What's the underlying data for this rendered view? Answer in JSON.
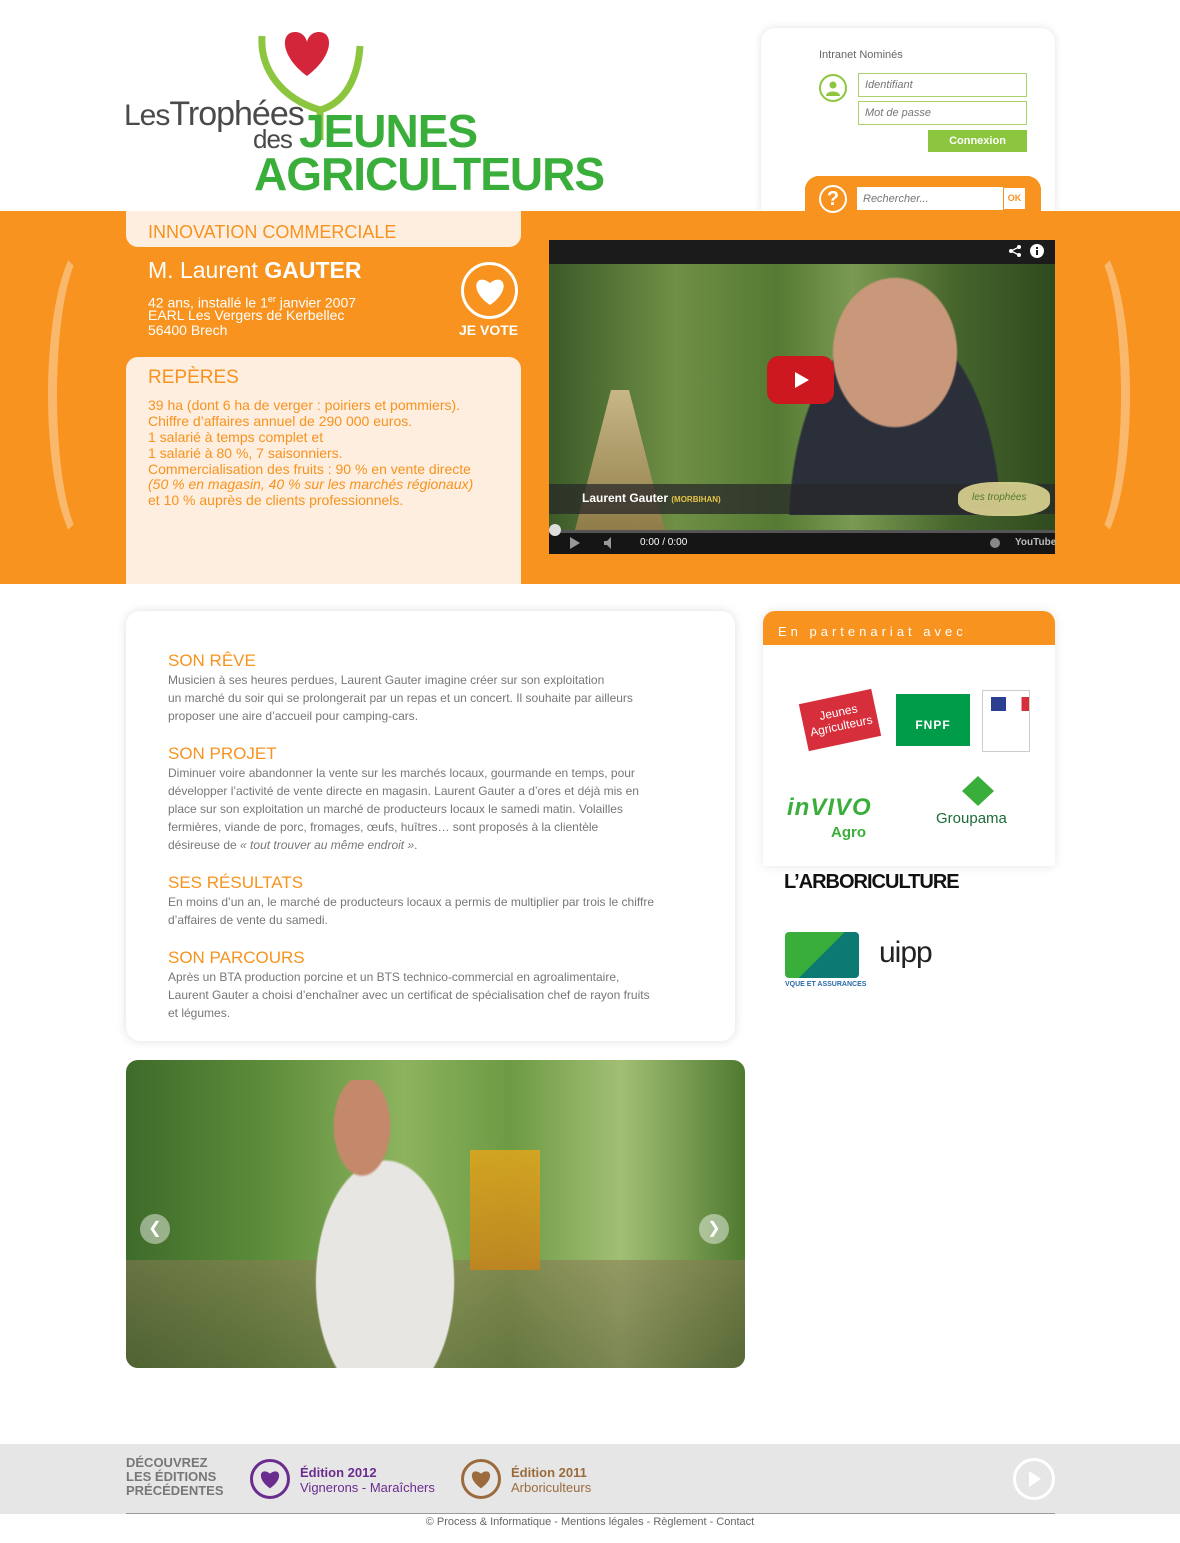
{
  "logo": {
    "les": "Les",
    "trophees": "Trophées",
    "des": "des",
    "jeunes": "JEUNES",
    "agriculteurs": "AGRICULTEURS"
  },
  "intranet": {
    "title": "Intranet Nominés",
    "login_placeholder": "Identifiant",
    "password_placeholder": "Mot de passe",
    "login_button": "Connexion"
  },
  "search": {
    "help_icon": "?",
    "placeholder": "Rechercher...",
    "button": "OK"
  },
  "nominee": {
    "category": "INNOVATION COMMERCIALE",
    "name_prefix": "M. Laurent",
    "name_last": "GAUTER",
    "info_line1": "42 ans, installé le 1",
    "info_line1_sup": "er",
    "info_line1_end": " janvier 2007",
    "info_line2": "EARL Les Vergers de Kerbellec",
    "info_line3": "56400 Brech",
    "vote_label": "JE VOTE"
  },
  "reperes": {
    "title": "REPÈRES",
    "lines": [
      "39 ha (dont 6 ha de verger : poiriers et pommiers).",
      "Chiffre d’affaires annuel de 290 000 euros.",
      "1 salarié à temps complet et",
      "1 salarié à 80 %, 7 saisonniers.",
      "Commercialisation des fruits : 90 % en vente directe",
      "(50 % en magasin, 40 % sur les marchés régionaux)",
      "et 10 % auprès de clients professionnels."
    ]
  },
  "video": {
    "caption_name": "Laurent Gauter",
    "caption_region": "(MORBIHAN)",
    "time": "0:00 / 0:00",
    "youtube": "YouTube",
    "logo_text": "les trophées"
  },
  "sections": {
    "reve_title": "SON RÊVE",
    "reve_lines": [
      "Musicien à ses heures perdues, Laurent Gauter imagine créer sur son exploitation",
      "un marché du soir qui se prolongerait par un repas et un concert. Il souhaite par ailleurs",
      "proposer une aire d’accueil pour camping-cars."
    ],
    "projet_title": "SON PROJET",
    "projet_lines": [
      "Diminuer voire abandonner la vente sur les marchés locaux, gourmande en temps, pour",
      "développer l’activité de vente directe en magasin. Laurent Gauter a d’ores et déjà mis en",
      "place sur son exploitation un marché de producteurs locaux le samedi matin. Volailles",
      "fermières, viande de porc, fromages, œufs, huîtres… sont proposés à la clientèle"
    ],
    "projet_last_start": "désireuse de ",
    "projet_last_italic": "« tout trouver au même endroit »",
    "projet_last_end": ".",
    "resultats_title": "SES RÉSULTATS",
    "resultats_lines": [
      "En moins d’un an, le marché de producteurs locaux a permis de multiplier par trois le chiffre",
      "d’affaires de vente du samedi."
    ],
    "parcours_title": "SON PARCOURS",
    "parcours_lines": [
      "Après un BTA production porcine et un BTS technico-commercial en agroalimentaire,",
      "Laurent Gauter a choisi d’enchaîner avec un certificat de spécialisation chef de rayon fruits",
      "et légumes."
    ]
  },
  "partners": {
    "title": "En partenariat avec",
    "ja": "Jeunes Agriculteurs",
    "fnpf": "FNPF",
    "invivo": "inVIVO",
    "agro": "Agro",
    "groupama": "Groupama",
    "arboriculture": "L’ARBORICULTURE",
    "ca_sub": "VQUE ET ASSURANCES",
    "uipp": "uipp"
  },
  "footer": {
    "discover": [
      "DÉCOUVREZ",
      "LES ÉDITIONS",
      "PRÉCÉDENTES"
    ],
    "edition2012_title": "Édition 2012",
    "edition2012_sub": "Vignerons - Maraîchers",
    "edition2011_title": "Édition 2011",
    "edition2011_sub": "Arboriculteurs",
    "links": "© Process & Informatique  -  Mentions légales  -  Règlement  -  Contact"
  },
  "colors": {
    "orange": "#f7931e",
    "green": "#3aae3a",
    "light_green": "#8cc63f",
    "purple_2012": "#6b2c8f",
    "brown_2011": "#9b6b3e"
  }
}
